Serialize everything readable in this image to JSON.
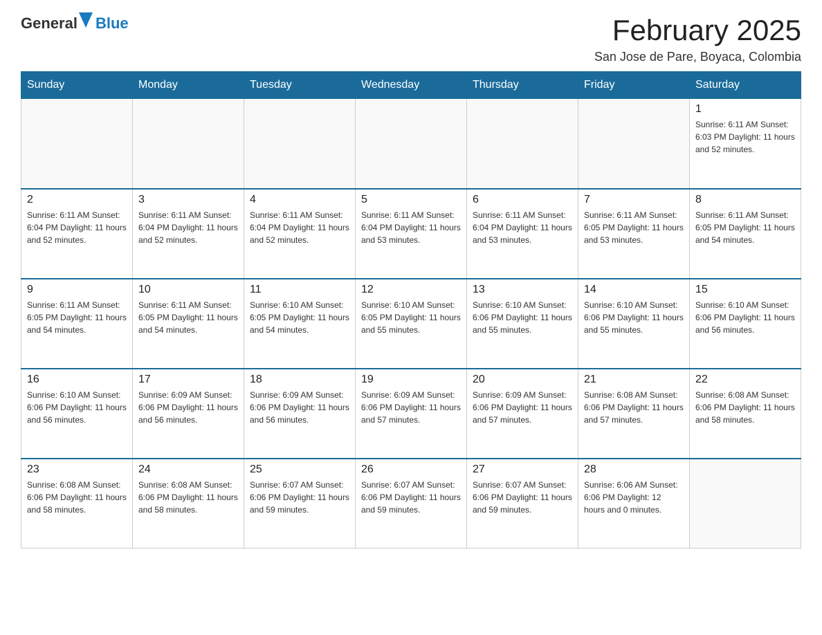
{
  "header": {
    "logo": {
      "general": "General",
      "blue": "Blue"
    },
    "title": "February 2025",
    "location": "San Jose de Pare, Boyaca, Colombia"
  },
  "days_of_week": [
    "Sunday",
    "Monday",
    "Tuesday",
    "Wednesday",
    "Thursday",
    "Friday",
    "Saturday"
  ],
  "weeks": [
    [
      {
        "day": "",
        "info": ""
      },
      {
        "day": "",
        "info": ""
      },
      {
        "day": "",
        "info": ""
      },
      {
        "day": "",
        "info": ""
      },
      {
        "day": "",
        "info": ""
      },
      {
        "day": "",
        "info": ""
      },
      {
        "day": "1",
        "info": "Sunrise: 6:11 AM\nSunset: 6:03 PM\nDaylight: 11 hours and 52 minutes."
      }
    ],
    [
      {
        "day": "2",
        "info": "Sunrise: 6:11 AM\nSunset: 6:04 PM\nDaylight: 11 hours and 52 minutes."
      },
      {
        "day": "3",
        "info": "Sunrise: 6:11 AM\nSunset: 6:04 PM\nDaylight: 11 hours and 52 minutes."
      },
      {
        "day": "4",
        "info": "Sunrise: 6:11 AM\nSunset: 6:04 PM\nDaylight: 11 hours and 52 minutes."
      },
      {
        "day": "5",
        "info": "Sunrise: 6:11 AM\nSunset: 6:04 PM\nDaylight: 11 hours and 53 minutes."
      },
      {
        "day": "6",
        "info": "Sunrise: 6:11 AM\nSunset: 6:04 PM\nDaylight: 11 hours and 53 minutes."
      },
      {
        "day": "7",
        "info": "Sunrise: 6:11 AM\nSunset: 6:05 PM\nDaylight: 11 hours and 53 minutes."
      },
      {
        "day": "8",
        "info": "Sunrise: 6:11 AM\nSunset: 6:05 PM\nDaylight: 11 hours and 54 minutes."
      }
    ],
    [
      {
        "day": "9",
        "info": "Sunrise: 6:11 AM\nSunset: 6:05 PM\nDaylight: 11 hours and 54 minutes."
      },
      {
        "day": "10",
        "info": "Sunrise: 6:11 AM\nSunset: 6:05 PM\nDaylight: 11 hours and 54 minutes."
      },
      {
        "day": "11",
        "info": "Sunrise: 6:10 AM\nSunset: 6:05 PM\nDaylight: 11 hours and 54 minutes."
      },
      {
        "day": "12",
        "info": "Sunrise: 6:10 AM\nSunset: 6:05 PM\nDaylight: 11 hours and 55 minutes."
      },
      {
        "day": "13",
        "info": "Sunrise: 6:10 AM\nSunset: 6:06 PM\nDaylight: 11 hours and 55 minutes."
      },
      {
        "day": "14",
        "info": "Sunrise: 6:10 AM\nSunset: 6:06 PM\nDaylight: 11 hours and 55 minutes."
      },
      {
        "day": "15",
        "info": "Sunrise: 6:10 AM\nSunset: 6:06 PM\nDaylight: 11 hours and 56 minutes."
      }
    ],
    [
      {
        "day": "16",
        "info": "Sunrise: 6:10 AM\nSunset: 6:06 PM\nDaylight: 11 hours and 56 minutes."
      },
      {
        "day": "17",
        "info": "Sunrise: 6:09 AM\nSunset: 6:06 PM\nDaylight: 11 hours and 56 minutes."
      },
      {
        "day": "18",
        "info": "Sunrise: 6:09 AM\nSunset: 6:06 PM\nDaylight: 11 hours and 56 minutes."
      },
      {
        "day": "19",
        "info": "Sunrise: 6:09 AM\nSunset: 6:06 PM\nDaylight: 11 hours and 57 minutes."
      },
      {
        "day": "20",
        "info": "Sunrise: 6:09 AM\nSunset: 6:06 PM\nDaylight: 11 hours and 57 minutes."
      },
      {
        "day": "21",
        "info": "Sunrise: 6:08 AM\nSunset: 6:06 PM\nDaylight: 11 hours and 57 minutes."
      },
      {
        "day": "22",
        "info": "Sunrise: 6:08 AM\nSunset: 6:06 PM\nDaylight: 11 hours and 58 minutes."
      }
    ],
    [
      {
        "day": "23",
        "info": "Sunrise: 6:08 AM\nSunset: 6:06 PM\nDaylight: 11 hours and 58 minutes."
      },
      {
        "day": "24",
        "info": "Sunrise: 6:08 AM\nSunset: 6:06 PM\nDaylight: 11 hours and 58 minutes."
      },
      {
        "day": "25",
        "info": "Sunrise: 6:07 AM\nSunset: 6:06 PM\nDaylight: 11 hours and 59 minutes."
      },
      {
        "day": "26",
        "info": "Sunrise: 6:07 AM\nSunset: 6:06 PM\nDaylight: 11 hours and 59 minutes."
      },
      {
        "day": "27",
        "info": "Sunrise: 6:07 AM\nSunset: 6:06 PM\nDaylight: 11 hours and 59 minutes."
      },
      {
        "day": "28",
        "info": "Sunrise: 6:06 AM\nSunset: 6:06 PM\nDaylight: 12 hours and 0 minutes."
      },
      {
        "day": "",
        "info": ""
      }
    ]
  ]
}
